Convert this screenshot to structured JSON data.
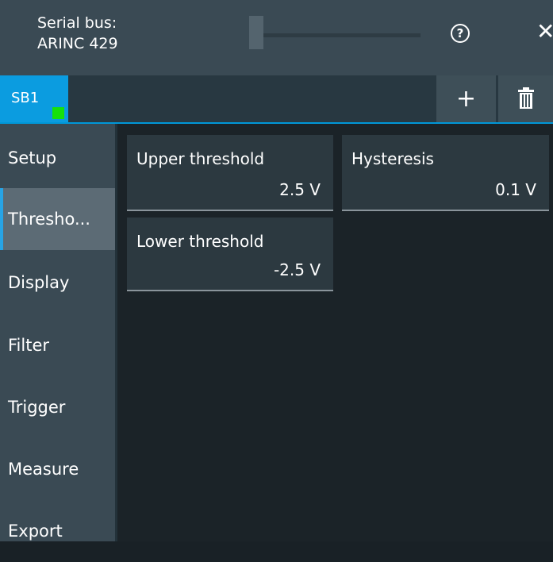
{
  "header": {
    "title_line1": "Serial bus:",
    "title_line2": "ARINC 429",
    "help_label": "?",
    "close_label": "✕"
  },
  "tabs": {
    "items": [
      {
        "label": "SB1",
        "active": true,
        "status_color": "#16e10c"
      }
    ],
    "add_label": "+",
    "delete_icon": "trash-icon"
  },
  "sidebar": {
    "items": [
      {
        "label": "Setup",
        "active": false
      },
      {
        "label": "Thresho...",
        "active": true
      },
      {
        "label": "Display",
        "active": false
      },
      {
        "label": "Filter",
        "active": false
      },
      {
        "label": "Trigger",
        "active": false
      },
      {
        "label": "Measure",
        "active": false
      },
      {
        "label": "Export",
        "active": false
      }
    ]
  },
  "fields": {
    "upper_threshold": {
      "label": "Upper threshold",
      "value": "2.5 V"
    },
    "hysteresis": {
      "label": "Hysteresis",
      "value": "0.1 V"
    },
    "lower_threshold": {
      "label": "Lower threshold",
      "value": "-2.5 V"
    }
  },
  "colors": {
    "accent": "#0b9ce0",
    "background": "#192126",
    "header": "#3a4a54",
    "field": "#2c3940"
  }
}
